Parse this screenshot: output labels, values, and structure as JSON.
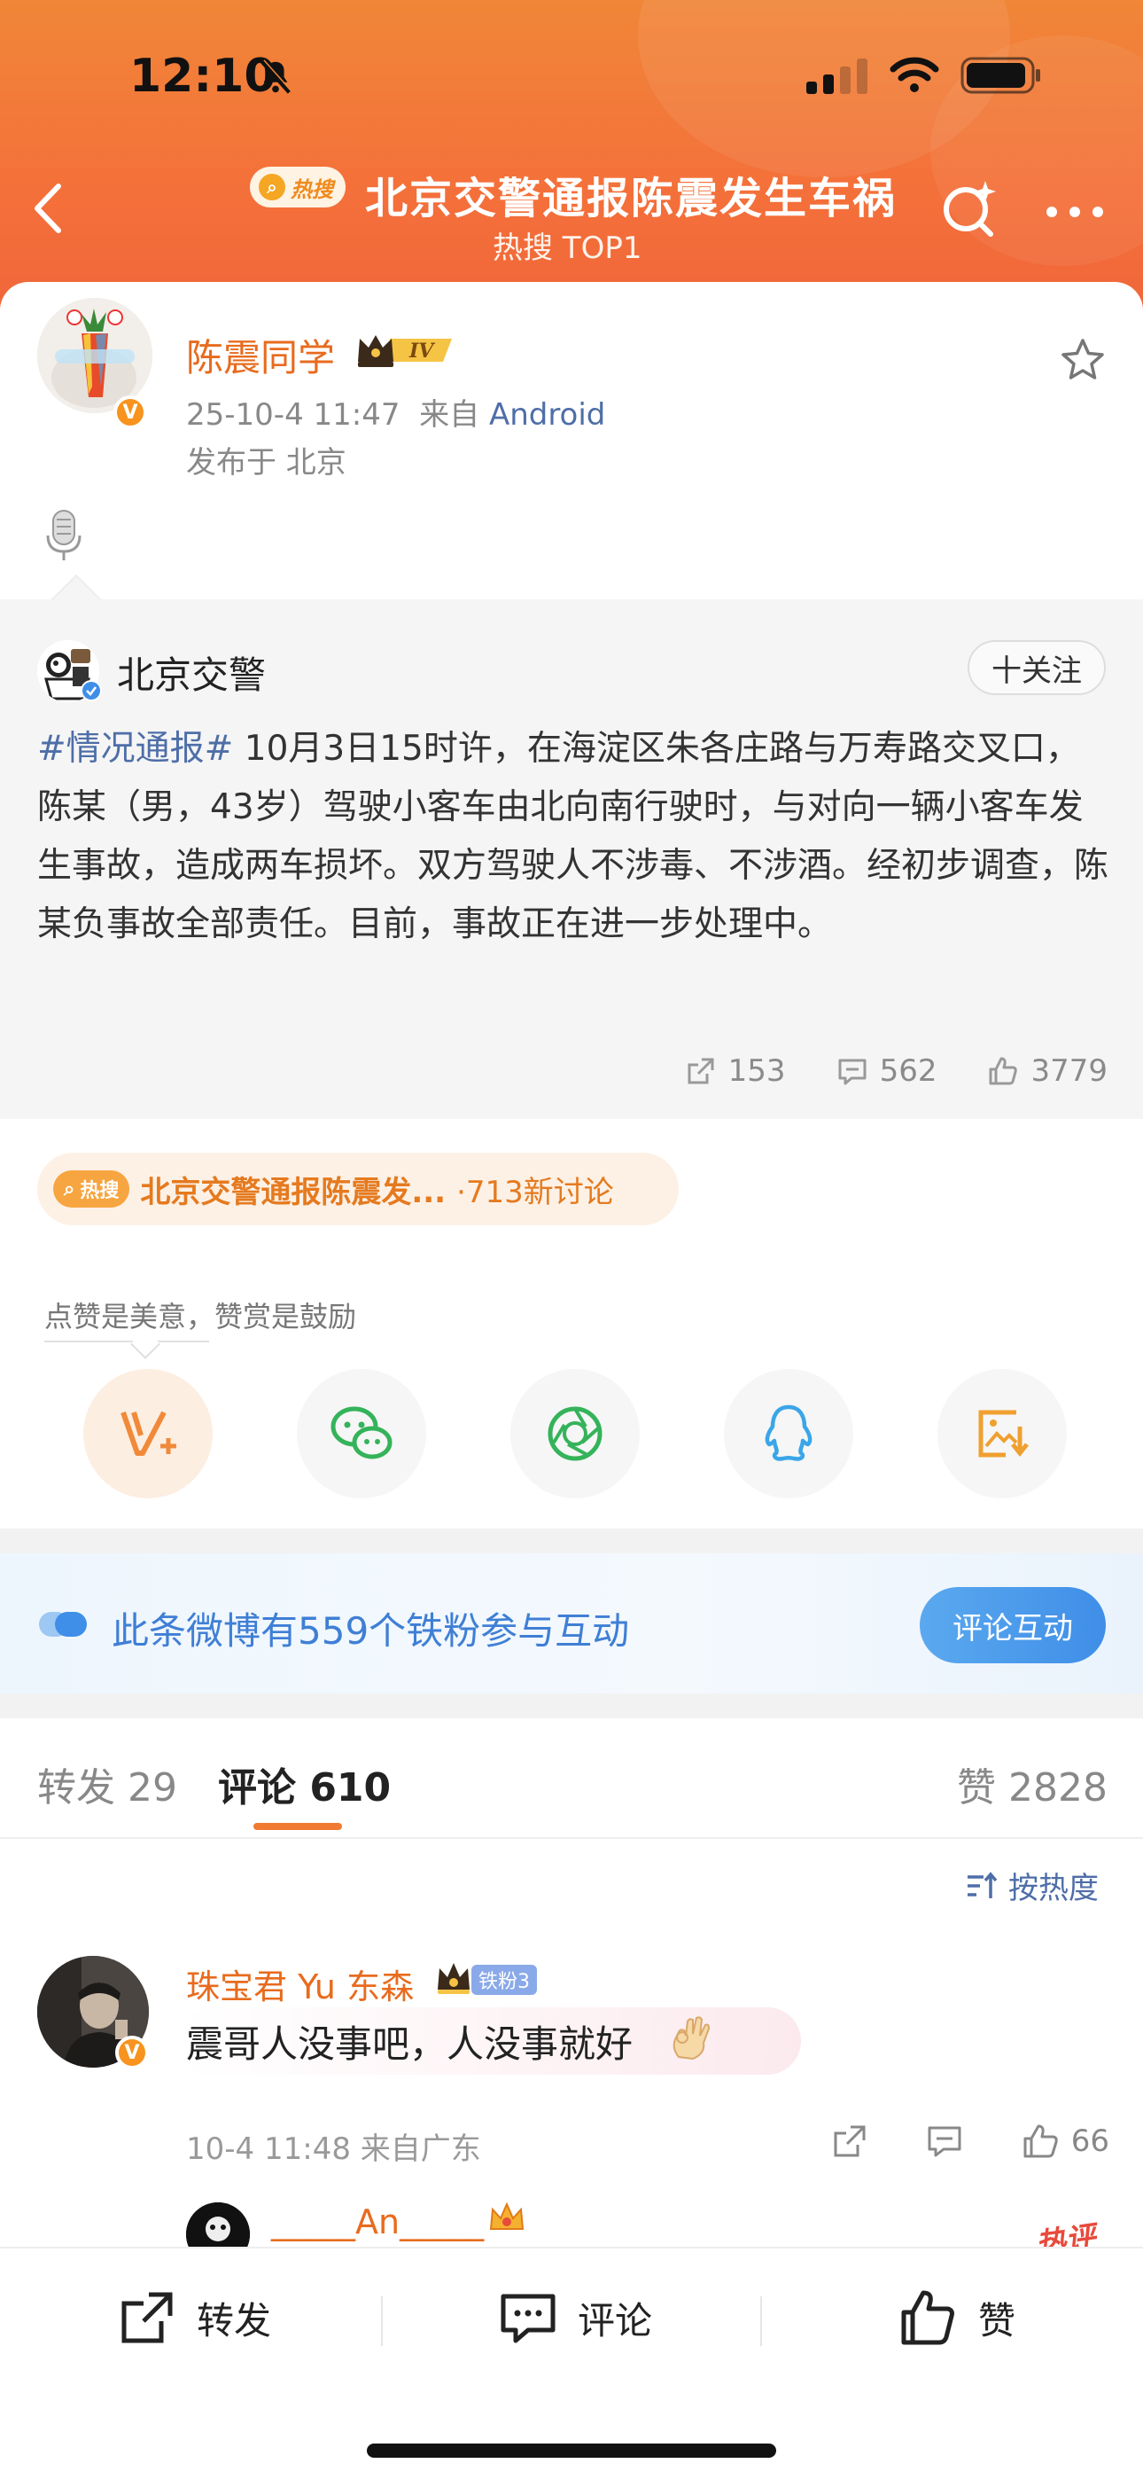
{
  "status_bar": {
    "time": "12:10"
  },
  "header": {
    "hot_label": "热搜",
    "title": "北京交警通报陈震发生车祸",
    "subtitle": "热搜 TOP1"
  },
  "post": {
    "author": "陈震同学",
    "level": "IV",
    "time": "25-10-4 11:47",
    "source_prefix": "来自",
    "source": "Android",
    "location": "发布于 北京"
  },
  "repost": {
    "author": "北京交警",
    "follow_label": "十关注",
    "hashtag": "#情况通报#",
    "body": " 10月3日15时许，在海淀区朱各庄路与万寿路交叉口，陈某（男，43岁）驾驶小客车由北向南行驶时，与对向一辆小客车发生事故，造成两车损坏。双方驾驶人不涉毒、不涉酒。经初步调查，陈某负事故全部责任。目前，事故正在进一步处理中。",
    "reposts": "153",
    "comments": "562",
    "likes": "3779"
  },
  "topic": {
    "hot_label": "热搜",
    "text": "北京交警通报陈震发...",
    "count": "·713新讨论"
  },
  "reward_tip": "点赞是美意，赞赏是鼓励",
  "share": {
    "icons": [
      "v-plus-icon",
      "wechat-icon",
      "moments-icon",
      "qq-icon",
      "save-image-icon"
    ]
  },
  "fans_banner": {
    "text": "此条微博有559个铁粉参与互动",
    "button": "评论互动"
  },
  "tabs": {
    "repost": "转发 29",
    "comment": "评论 610",
    "like": "赞 2828"
  },
  "sort_label": "按热度",
  "comment": {
    "author": "珠宝君 Yu 东森",
    "fan_badge": "铁粉3",
    "text": "震哥人没事吧，人没事就好",
    "meta": "10-4 11:48  来自广东",
    "likes": "66"
  },
  "reply_preview": {
    "author": "_____An_____",
    "stamp": "热评"
  },
  "bottom_bar": {
    "repost": "转发",
    "comment": "评论",
    "like": "赞"
  },
  "colors": {
    "header_orange": "#f4703a",
    "name_orange": "#e86b1e",
    "link_blue": "#4e6ea8",
    "fans_blue": "#3f7fd5"
  }
}
